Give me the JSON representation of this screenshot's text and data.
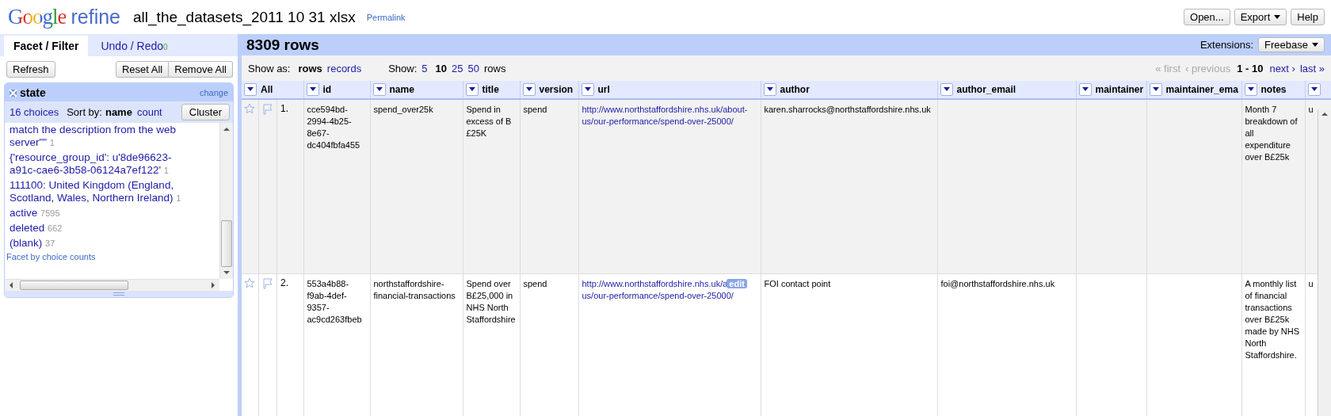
{
  "header": {
    "logo_google": "Google",
    "logo_product": "refine",
    "project_title": "all_the_datasets_2011 10 31 xlsx",
    "permalink": "Permalink",
    "buttons": [
      {
        "label": "Open...",
        "menu": false
      },
      {
        "label": "Export",
        "menu": true
      },
      {
        "label": "Help",
        "menu": false
      }
    ]
  },
  "left_panel": {
    "tabs": [
      {
        "label": "Facet / Filter",
        "selected": true
      },
      {
        "label": "Undo / Redo",
        "count": "0",
        "selected": false
      }
    ],
    "refresh": "Refresh",
    "reset_all": "Reset All",
    "remove_all": "Remove All",
    "facet": {
      "title": "state",
      "change": "change",
      "choices_count": "16 choices",
      "sort_label": "Sort by:",
      "sort_options": [
        {
          "label": "name",
          "selected": true
        },
        {
          "label": "count",
          "selected": false
        }
      ],
      "cluster": "Cluster",
      "choices": [
        {
          "label": "match the description from the web server\"\"",
          "count": "1"
        },
        {
          "label": "{'resource_group_id': u'8de96623-a91c-cae6-3b58-06124a7ef122'",
          "count": "1"
        },
        {
          "label": "111100: United Kingdom (England, Scotland, Wales, Northern Ireland)",
          "count": "1"
        },
        {
          "label": "active",
          "count": "7595"
        },
        {
          "label": "deleted",
          "count": "662"
        },
        {
          "label": "(blank)",
          "count": "37"
        }
      ],
      "facet_by_counts": "Facet by choice counts"
    }
  },
  "main": {
    "row_count": "8309 rows",
    "extensions_label": "Extensions:",
    "extensions_button": "Freebase",
    "show_as_label": "Show as:",
    "show_as": [
      {
        "label": "rows",
        "selected": true
      },
      {
        "label": "records",
        "selected": false
      }
    ],
    "show_label": "Show:",
    "page_sizes": [
      {
        "label": "5",
        "selected": false
      },
      {
        "label": "10",
        "selected": true
      },
      {
        "label": "25",
        "selected": false
      },
      {
        "label": "50",
        "selected": false
      }
    ],
    "page_sizes_suffix": "rows",
    "pager": [
      {
        "label": "« first",
        "disabled": true
      },
      {
        "label": "‹ previous",
        "disabled": true
      },
      {
        "label": "1 - 10",
        "kind": "range"
      },
      {
        "label": "next ›",
        "disabled": false
      },
      {
        "label": "last »",
        "disabled": false
      }
    ],
    "table": {
      "columns": [
        {
          "label": "All"
        },
        {
          "label": "id"
        },
        {
          "label": "name"
        },
        {
          "label": "title"
        },
        {
          "label": "version"
        },
        {
          "label": "url"
        },
        {
          "label": "author"
        },
        {
          "label": "author_email"
        },
        {
          "label": "maintainer"
        },
        {
          "label": "maintainer_ema"
        },
        {
          "label": "notes"
        },
        {}
      ],
      "rows": [
        {
          "cells": [
            {
              "kind": "row_header",
              "starred": false,
              "flagged": false,
              "index": "1."
            },
            {
              "text": "cce594bd-2994-4b25-8e67-dc404fbfa455"
            },
            {
              "text": "spend_over25k"
            },
            {
              "text": "Spend in excess of B £25K"
            },
            {
              "text": "spend"
            },
            {
              "kind": "link",
              "lines": [
                "http://www.northstaffordshire.nhs.uk/about-",
                "us/our-performance/spend-over-25000/"
              ]
            },
            {
              "text": "karen.sharrocks@northstaffordshire.nhs.uk"
            },
            {},
            {},
            {},
            {
              "text": "Month 7 breakdown of all expenditure over B£25k"
            },
            {
              "text": "u"
            }
          ]
        },
        {
          "cells": [
            {
              "kind": "row_header",
              "starred": false,
              "flagged": false,
              "index": "2."
            },
            {
              "text": "553a4b88-f9ab-4def-9357-ac9cd263fbeb"
            },
            {
              "text": "northstaffordshire-financial-transactions"
            },
            {
              "text": "Spend over B£25,000 in NHS North Staffordshire"
            },
            {
              "text": "spend"
            },
            {
              "kind": "link",
              "lines": [
                "http://www.northstaffordshire.nhs.uk/a",
                "us/our-performance/spend-over-25000/"
              ],
              "badge": "edit"
            },
            {
              "text": "FOI contact point"
            },
            {
              "text": "foi@northstaffordshire.nhs.uk"
            },
            {},
            {},
            {
              "text": "A monthly list of financial transactions over B£25k made by NHS North Staffordshire."
            },
            {
              "text": "u"
            }
          ]
        }
      ]
    }
  }
}
